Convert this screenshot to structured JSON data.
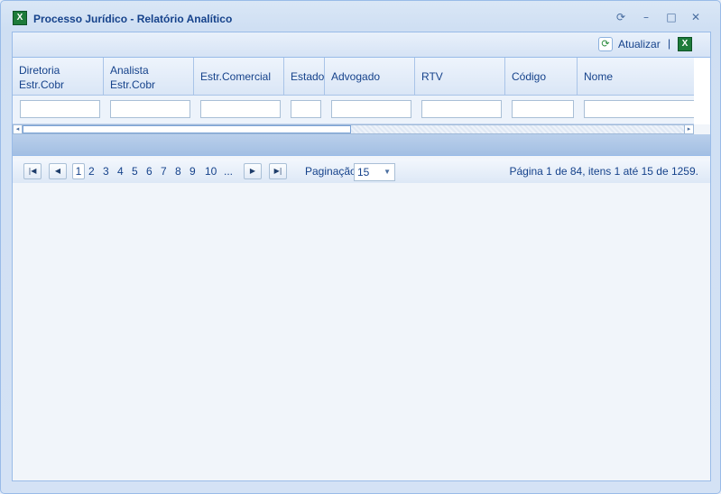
{
  "window": {
    "title": "Processo Jurídico - Relatório Analítico",
    "icon": "excel-icon",
    "tools": {
      "refresh": "⟳",
      "minimize": "–",
      "maximize": "□",
      "close": "✕"
    }
  },
  "toolbar": {
    "refresh_label": "Atualizar",
    "separator": "|",
    "export_icon": "excel-export-icon"
  },
  "grid": {
    "columns": [
      {
        "label": "Diretoria\nEstr.Cobr"
      },
      {
        "label": "Analista\nEstr.Cobr"
      },
      {
        "label": "Estr.Comercial"
      },
      {
        "label": "Estado"
      },
      {
        "label": "Advogado"
      },
      {
        "label": "RTV"
      },
      {
        "label": "Código"
      },
      {
        "label": "Nome"
      }
    ]
  },
  "pager": {
    "pages": [
      "1",
      "2",
      "3",
      "4",
      "5",
      "6",
      "7",
      "8",
      "9",
      "10",
      "..."
    ],
    "current_page": "1",
    "pagination_label": "Paginação",
    "page_size": "15",
    "info": "Página 1 de 84, itens 1 até 15 de 1259."
  },
  "colors": {
    "accent": "#15428b",
    "border": "#99bbe8",
    "background": "#dfe8f6"
  }
}
